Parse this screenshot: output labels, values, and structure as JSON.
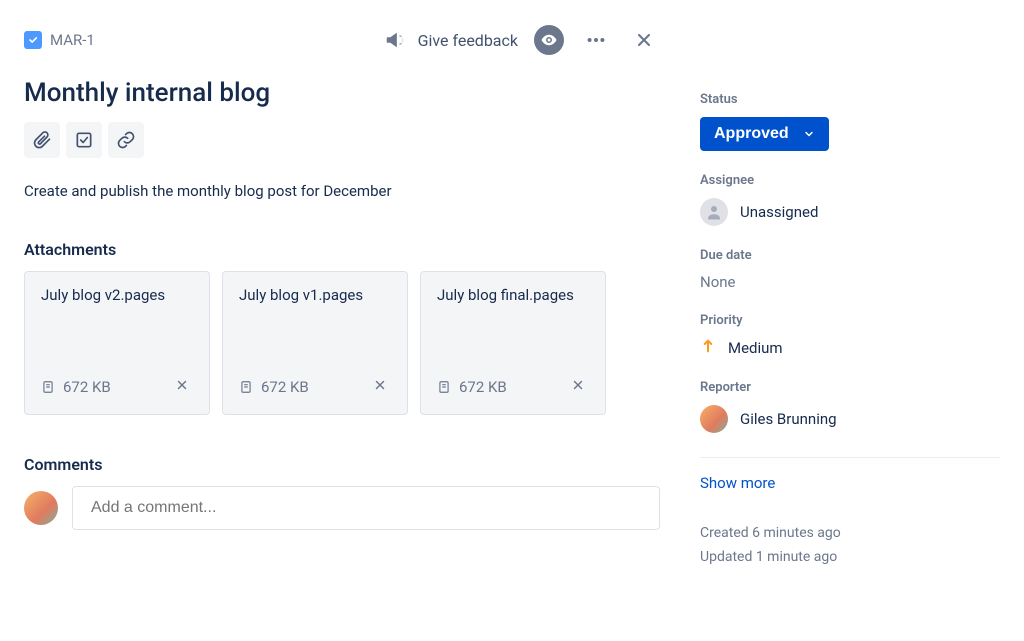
{
  "breadcrumb": {
    "issueKey": "MAR-1"
  },
  "header": {
    "feedback": "Give feedback"
  },
  "issue": {
    "title": "Monthly internal blog",
    "description": "Create and publish the monthly blog post for December"
  },
  "sections": {
    "attachments": "Attachments",
    "comments": "Comments"
  },
  "attachments": [
    {
      "name": "July blog v2.pages",
      "size": "672 KB"
    },
    {
      "name": "July blog v1.pages",
      "size": "672 KB"
    },
    {
      "name": "July blog final.pages",
      "size": "672 KB"
    }
  ],
  "comments": {
    "placeholder": "Add a comment..."
  },
  "sidebar": {
    "statusLabel": "Status",
    "statusValue": "Approved",
    "assigneeLabel": "Assignee",
    "assigneeValue": "Unassigned",
    "dueDateLabel": "Due date",
    "dueDateValue": "None",
    "priorityLabel": "Priority",
    "priorityValue": "Medium",
    "reporterLabel": "Reporter",
    "reporterValue": "Giles Brunning",
    "showMore": "Show more",
    "created": "Created 6 minutes ago",
    "updated": "Updated 1 minute ago"
  }
}
